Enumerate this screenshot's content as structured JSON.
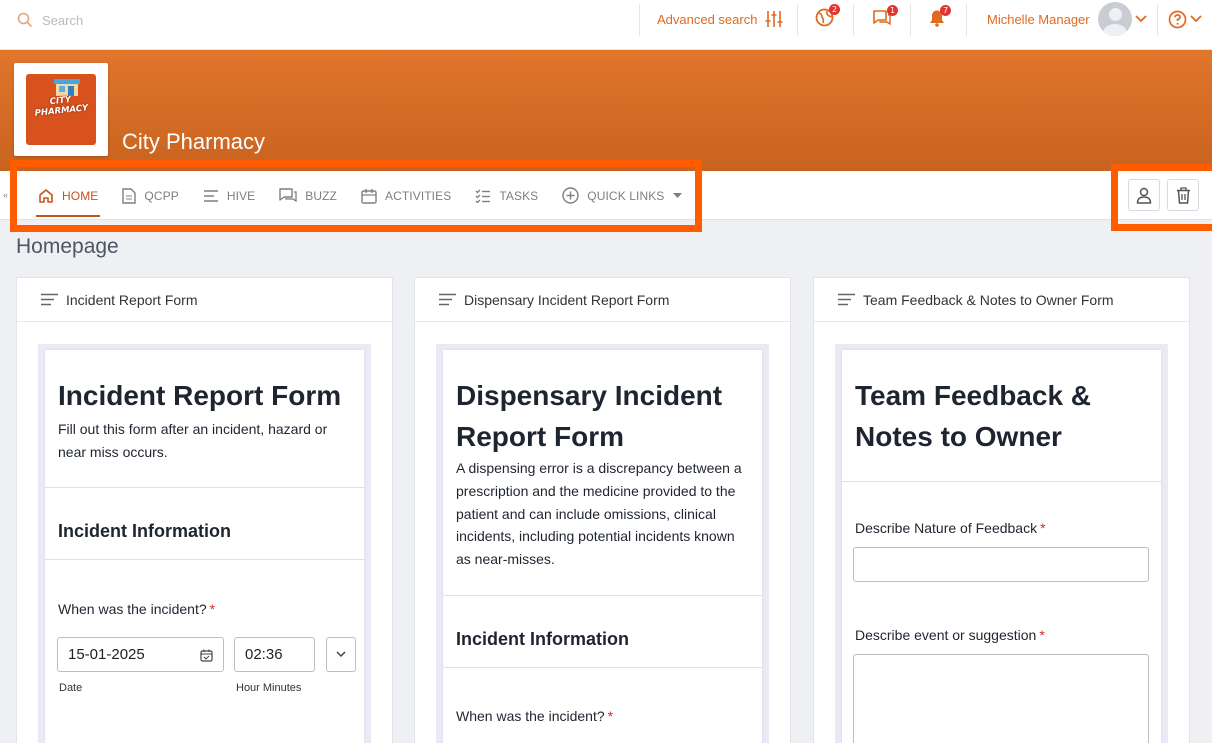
{
  "topbar": {
    "search_placeholder": "Search",
    "advanced_search": "Advanced search",
    "globe_badge": "2",
    "chat_badge": "1",
    "bell_badge": "7",
    "user_name": "Michelle Manager"
  },
  "banner": {
    "logo_text": "CITY PHARMACY",
    "brand_name": "City Pharmacy"
  },
  "nav": {
    "items": [
      {
        "label": "HOME",
        "icon": "home-icon",
        "active": true
      },
      {
        "label": "QCPP",
        "icon": "document-icon"
      },
      {
        "label": "HIVE",
        "icon": "lines-icon"
      },
      {
        "label": "BUZZ",
        "icon": "chat-icon"
      },
      {
        "label": "ACTIVITIES",
        "icon": "calendar-icon"
      },
      {
        "label": "TASKS",
        "icon": "checklist-icon"
      },
      {
        "label": "QUICK LINKS",
        "icon": "plus-circle-icon"
      }
    ]
  },
  "page": {
    "title": "Homepage"
  },
  "cards": [
    {
      "header": "Incident Report Form",
      "form_title": "Incident Report Form",
      "form_desc": "Fill out this form after an incident, hazard or near miss occurs.",
      "section": "Incident Information",
      "question": "When was the incident?",
      "date_value": "15-01-2025",
      "time_value": "02:36",
      "date_caption": "Date",
      "time_caption": "Hour Minutes"
    },
    {
      "header": "Dispensary Incident Report Form",
      "form_title_line1": "Dispensary Incident",
      "form_title_line2": "Report Form",
      "form_desc": "A dispensing error is a discrepancy between a prescription and the medicine provided to the patient and can include omissions, clinical incidents, including potential incidents known as near-misses.",
      "section": "Incident Information",
      "question": "When was the incident?"
    },
    {
      "header": "Team Feedback & Notes to Owner Form",
      "form_title_line1": "Team Feedback &",
      "form_title_line2": "Notes to Owner",
      "field1_label": "Describe Nature of Feedback",
      "field2_label": "Describe event or suggestion"
    }
  ],
  "colors": {
    "accent": "#e06a1f",
    "highlight": "#ff5c00",
    "banner": "#d56a25"
  }
}
